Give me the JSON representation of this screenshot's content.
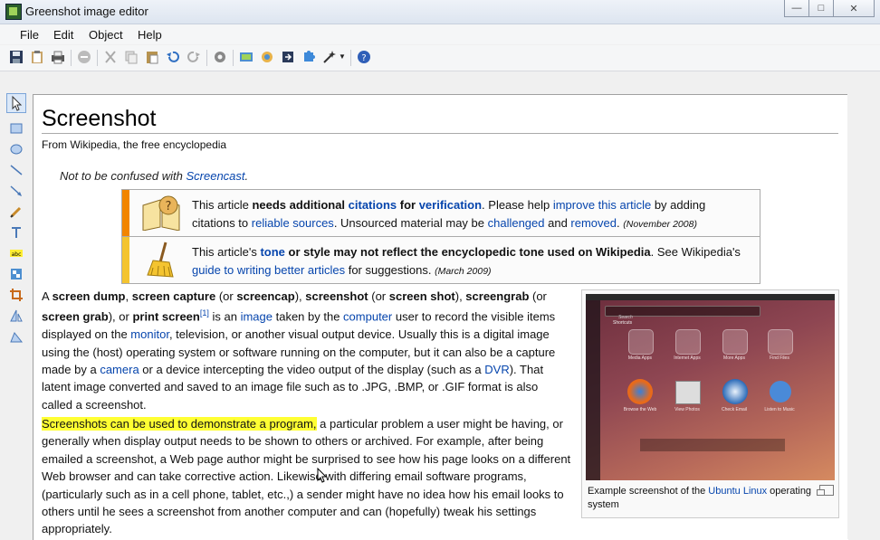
{
  "window": {
    "title": "Greenshot image editor"
  },
  "menu": [
    "File",
    "Edit",
    "Object",
    "Help"
  ],
  "article": {
    "title": "Screenshot",
    "tagline": "From Wikipedia, the free encyclopedia",
    "hatnote_prefix": "Not to be confused with ",
    "hatnote_link": "Screencast",
    "hatnote_suffix": ".",
    "box1": {
      "t1": "This article ",
      "b1": "needs additional ",
      "l1": "citations",
      "b2": " for ",
      "l2": "verification",
      "t2": ". Please help ",
      "l3": "improve this article",
      "t3": " by adding citations to ",
      "l4": "reliable sources",
      "t4": ". Unsourced material may be ",
      "l5": "challenged",
      "t5": " and ",
      "l6": "removed",
      "t6": ". ",
      "date": "(November 2008)"
    },
    "box2": {
      "t1": "This article's ",
      "l1": "tone",
      "b1": " or style may not reflect the encyclopedic tone used on Wikipedia",
      "t2": ". See Wikipedia's ",
      "l2": "guide to writing better articles",
      "t3": " for suggestions. ",
      "date": "(March 2009)"
    },
    "p1": {
      "s1": "A ",
      "b1": "screen dump",
      "s2": ", ",
      "b2": "screen capture",
      "s3": " (or ",
      "b3": "screencap",
      "s4": "), ",
      "b4": "screenshot",
      "s5": " (or ",
      "b5": "screen shot",
      "s6": "), ",
      "b6": "screengrab",
      "s7": " (or ",
      "b7": "screen grab",
      "s8": "), or ",
      "b8": "print screen",
      "ref": "[1]",
      "s9": " is an ",
      "l1": "image",
      "s10": " taken by the ",
      "l2": "computer",
      "s11": " user to record the visible items displayed on the ",
      "l3": "monitor",
      "s12": ", television, or another visual output device. Usually this is a digital image using the (host) operating system or software running on the computer, but it can also be a capture made by a ",
      "l4": "camera",
      "s13": " or a device intercepting the video output of the display (such as a ",
      "l5": "DVR",
      "s14": "). That latent image converted and saved to an image file such as to .JPG, .BMP, or .GIF format is also called a screenshot."
    },
    "p2": {
      "highlight": "Screenshots can be used to demonstrate a program,",
      "rest": " a particular problem a user might be having, or generally when display output needs to be shown to others or archived. For example, after being emailed a screenshot, a Web page author might be surprised to see how his page looks on a different Web browser and can take corrective action. Likewise with differing email software programs, (particularly such as in a cell phone, tablet, etc.,) a sender might have no idea how his email looks to others until he sees a screenshot from another computer and can (hopefully) tweak his settings appropriately."
    },
    "thumb": {
      "search_placeholder": "Search",
      "section": "Shortcuts",
      "tiles": [
        "Media Apps",
        "Internet Apps",
        "More Apps",
        "Find Files",
        "Browse the Web",
        "View Photos",
        "Check Email",
        "Listen to Music"
      ],
      "caption_pre": "Example screenshot of the ",
      "caption_link": "Ubuntu Linux",
      "caption_post": " operating system"
    }
  },
  "colors": {
    "ambox_orange": "#f28500",
    "ambox_yellow": "#f4c430",
    "link": "#0645ad",
    "highlight": "#ffff33"
  }
}
